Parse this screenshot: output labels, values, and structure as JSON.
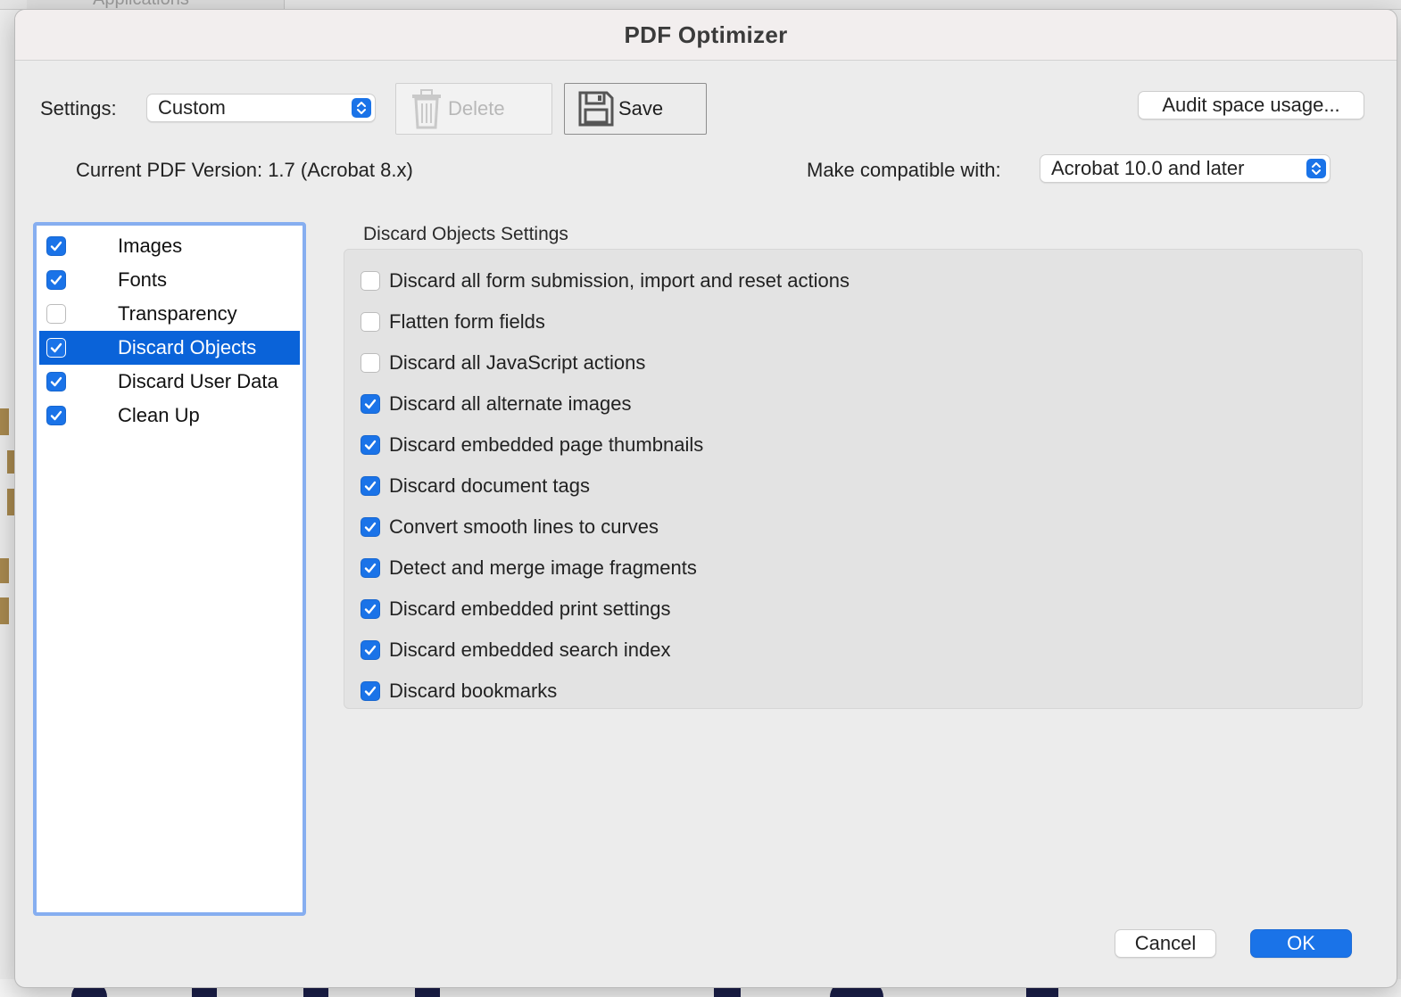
{
  "background": {
    "topbar_text": "Applications"
  },
  "dialog": {
    "title": "PDF Optimizer"
  },
  "settings": {
    "label": "Settings:",
    "value": "Custom"
  },
  "toolbar": {
    "delete_label": "Delete",
    "save_label": "Save",
    "audit_label": "Audit space usage..."
  },
  "version": {
    "current_text": "Current PDF Version: 1.7 (Acrobat 8.x)",
    "compat_label": "Make compatible with:",
    "compat_value": "Acrobat 10.0 and later"
  },
  "categories": [
    {
      "label": "Images",
      "checked": true,
      "selected": false
    },
    {
      "label": "Fonts",
      "checked": true,
      "selected": false
    },
    {
      "label": "Transparency",
      "checked": false,
      "selected": false
    },
    {
      "label": "Discard Objects",
      "checked": true,
      "selected": true
    },
    {
      "label": "Discard User Data",
      "checked": true,
      "selected": false
    },
    {
      "label": "Clean Up",
      "checked": true,
      "selected": false
    }
  ],
  "discard_objects": {
    "title": "Discard Objects Settings",
    "options": [
      {
        "label": "Discard all form submission, import and reset actions",
        "checked": false
      },
      {
        "label": "Flatten form fields",
        "checked": false
      },
      {
        "label": "Discard all JavaScript actions",
        "checked": false
      },
      {
        "label": "Discard all alternate images",
        "checked": true
      },
      {
        "label": "Discard embedded page thumbnails",
        "checked": true
      },
      {
        "label": "Discard document tags",
        "checked": true
      },
      {
        "label": "Convert smooth lines to curves",
        "checked": true
      },
      {
        "label": "Detect and merge image fragments",
        "checked": true
      },
      {
        "label": "Discard embedded print settings",
        "checked": true
      },
      {
        "label": "Discard embedded search index",
        "checked": true
      },
      {
        "label": "Discard bookmarks",
        "checked": true
      }
    ]
  },
  "footer": {
    "cancel_label": "Cancel",
    "ok_label": "OK"
  },
  "colors": {
    "accent": "#1a73e8",
    "selection": "#0a63d9",
    "list_focus_ring": "#86aef0"
  }
}
